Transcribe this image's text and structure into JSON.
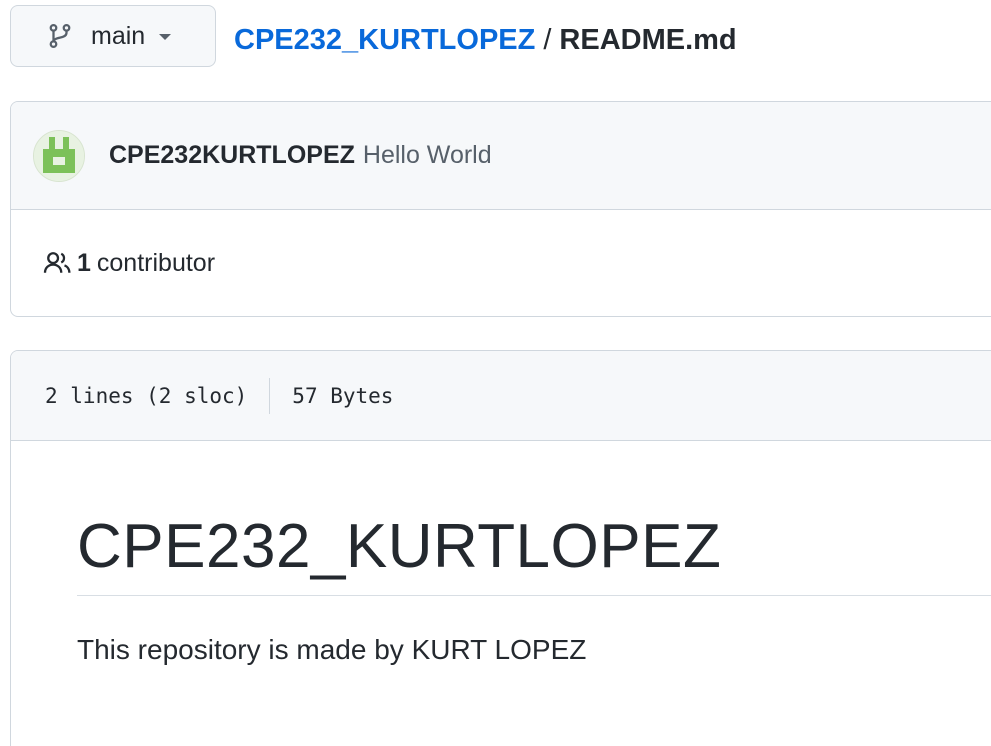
{
  "branch": {
    "name": "main",
    "icon": "git-branch-icon"
  },
  "breadcrumb": {
    "repo": "CPE232_KURTLOPEZ",
    "separator": "/",
    "file": "README.md"
  },
  "commit": {
    "avatar_icon": "identicon-avatar",
    "author": "CPE232KURTLOPEZ",
    "message": "Hello World"
  },
  "contributors": {
    "icon": "people-icon",
    "count": "1",
    "label": "contributor"
  },
  "file_info": {
    "lines": "2 lines (2 sloc)",
    "size": "57 Bytes"
  },
  "readme": {
    "heading": "CPE232_KURTLOPEZ",
    "body": "This repository is made by KURT LOPEZ"
  },
  "colors": {
    "link": "#0969da",
    "text": "#24292f",
    "muted": "#57606a",
    "border": "#d0d7de",
    "avatar": "#7cc159"
  }
}
